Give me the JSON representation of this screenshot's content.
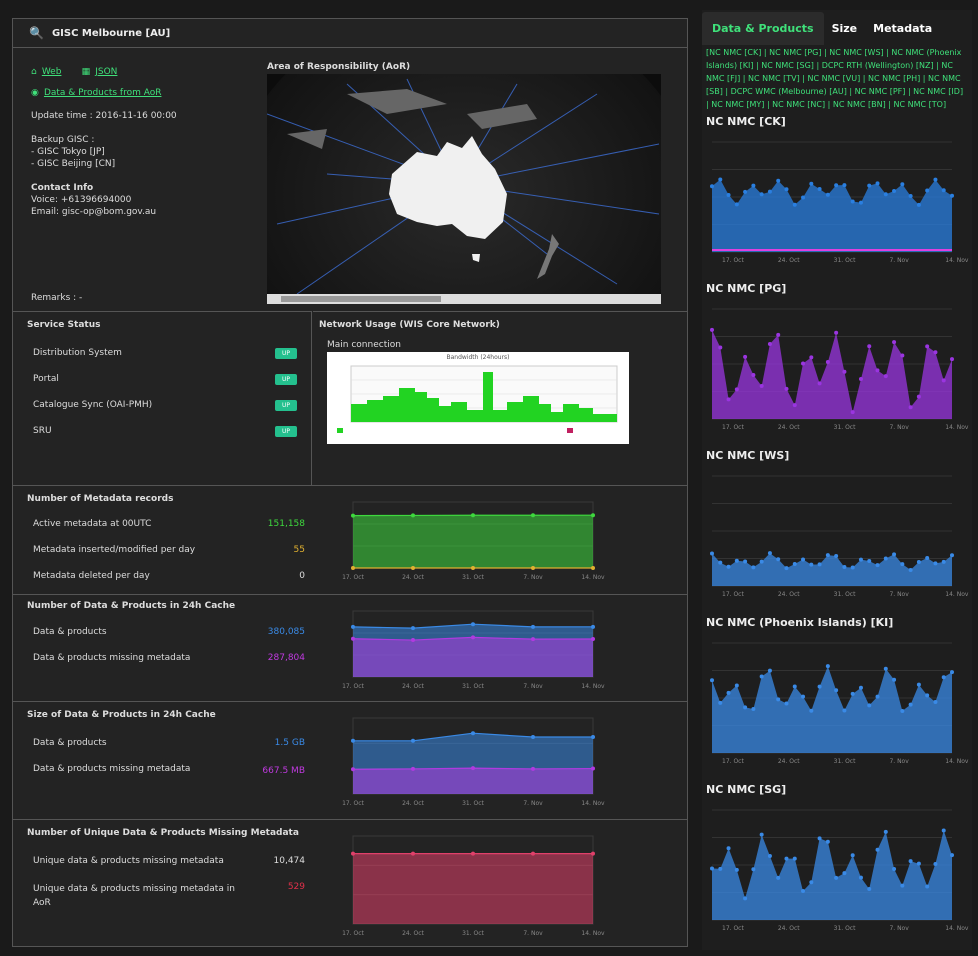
{
  "header": {
    "title": "GISC Melbourne [AU]"
  },
  "links": {
    "web": "Web",
    "json": "JSON",
    "data_products_aor": "Data & Products from AoR"
  },
  "info": {
    "update_time": "Update time :  2016-11-16 00:00",
    "backup_title": "Backup GISC :",
    "backup_items": [
      "-  GISC Tokyo [JP]",
      "-  GISC Beijing [CN]"
    ],
    "contact_title": "Contact Info",
    "voice": "Voice:  +61396694000",
    "email": "Email:  gisc-op@bom.gov.au",
    "remarks": "Remarks : -"
  },
  "aor": {
    "title": "Area of Responsibility (AoR)"
  },
  "service_status": {
    "title": "Service Status",
    "items": [
      {
        "label": "Distribution System",
        "status": "UP"
      },
      {
        "label": "Portal",
        "status": "UP"
      },
      {
        "label": "Catalogue Sync (OAI-PMH)",
        "status": "UP"
      },
      {
        "label": "SRU",
        "status": "UP"
      }
    ]
  },
  "network": {
    "title": "Network Usage (WIS Core Network)",
    "subtitle": "Main connection",
    "chart_title": "Bandwidth (24hours)"
  },
  "metadata": {
    "title": "Number of Metadata records",
    "rows": [
      {
        "label": "Active metadata at 00UTC",
        "value": "151,158",
        "color": "#3ed93e"
      },
      {
        "label": "Metadata inserted/modified per day",
        "value": "55",
        "color": "#e0b030"
      },
      {
        "label": "Metadata deleted per day",
        "value": "0",
        "color": "#dddddd"
      }
    ]
  },
  "cache_count": {
    "title": "Number of Data & Products in 24h Cache",
    "rows": [
      {
        "label": "Data & products",
        "value": "380,085",
        "color": "#3a8ae6"
      },
      {
        "label": "Data & products missing metadata",
        "value": "287,804",
        "color": "#c03ae0"
      }
    ]
  },
  "cache_size": {
    "title": "Size of Data & Products in 24h Cache",
    "rows": [
      {
        "label": "Data & products",
        "value": "1.5 GB",
        "color": "#3a8ae6"
      },
      {
        "label": "Data & products missing metadata",
        "value": "667.5 MB",
        "color": "#c03ae0"
      }
    ]
  },
  "unique_missing": {
    "title": "Number of Unique Data & Products Missing Metadata",
    "rows": [
      {
        "label": "Unique data & products missing metadata",
        "value": "10,474",
        "color": "#dddddd"
      },
      {
        "label": "Unique data & products missing metadata in AoR",
        "value": "529",
        "color": "#e0304a"
      }
    ]
  },
  "right": {
    "tabs": [
      "Data & Products",
      "Size",
      "Metadata"
    ],
    "nc_links": "[NC NMC [CK] | NC NMC [PG] | NC NMC [WS] | NC NMC (Phoenix Islands) [KI] | NC NMC [SG] | DCPC RTH (Wellington) [NZ] | NC NMC [FJ] | NC NMC [TV] | NC NMC [VU] | NC NMC [PH] | NC NMC [SB] | DCPC WMC (Melbourne) [AU] | NC NMC [PF] | NC NMC [ID] | NC NMC [MY] | NC NMC [NC] | NC NMC [BN] | NC NMC [TO]",
    "chart_titles": [
      "NC NMC [CK]",
      "NC NMC [PG]",
      "NC NMC [WS]",
      "NC NMC (Phoenix Islands) [KI]",
      "NC NMC [SG]"
    ]
  },
  "date_ticks": [
    "17. Oct",
    "24. Oct",
    "31. Oct",
    "7. Nov",
    "14. Nov"
  ],
  "chart_data": [
    {
      "type": "area",
      "title": "",
      "categories_note": "",
      "x": [
        "17. Oct",
        "24. Oct",
        "31. Oct",
        "7. Nov",
        "14. Nov"
      ],
      "series": [
        {
          "values": [
            150000,
            150500,
            151000,
            151000,
            151158
          ]
        },
        {
          "values": [
            0,
            0,
            20,
            80,
            0
          ]
        }
      ]
    },
    {
      "type": "area",
      "x": [
        "17. Oct",
        "24. Oct",
        "31. Oct",
        "7. Nov",
        "14. Nov"
      ],
      "series": [
        {
          "values": [
            380000,
            370000,
            400000,
            380000,
            380085
          ]
        },
        {
          "values": [
            290000,
            280000,
            300000,
            287000,
            287804
          ]
        }
      ]
    },
    {
      "type": "area",
      "x": [
        "17. Oct",
        "24. Oct",
        "31. Oct",
        "7. Nov",
        "14. Nov"
      ],
      "series": [
        {
          "values": [
            1.4,
            1.4,
            1.6,
            1.5,
            1.5
          ]
        },
        {
          "values": [
            0.65,
            0.66,
            0.68,
            0.66,
            0.67
          ]
        }
      ]
    },
    {
      "type": "area",
      "x": [
        "17. Oct",
        "24. Oct",
        "31. Oct",
        "7. Nov",
        "14. Nov"
      ],
      "series": [
        {
          "values": [
            10474,
            10474,
            10474,
            10474,
            10474
          ]
        }
      ]
    }
  ]
}
